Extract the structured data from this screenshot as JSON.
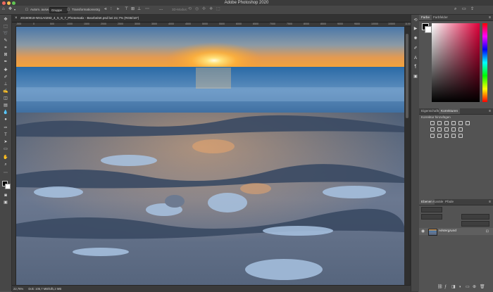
{
  "app": {
    "title": "Adobe Photoshop 2020"
  },
  "options_bar": {
    "mode_label": "Autom. ausw.:",
    "mode_value": "Gruppe",
    "transform_label": "Transformationsstrg",
    "mode3d_label": "3D-Modus:",
    "more_label": "..."
  },
  "document": {
    "tab_title": "20190919-NN1A0293_4_5_6_7_Photomatix - Bearbeitet.psd bei 22,7% (RGB/16*)",
    "close_glyph": "×",
    "zoom": "22,76%",
    "doc_info": "Dok: 105,7 MB/531,2 MB"
  },
  "ruler": {
    "labels": [
      "-500",
      "0",
      "500",
      "1000",
      "1500",
      "2000",
      "2500",
      "3000",
      "3500",
      "4000",
      "4500",
      "5000",
      "5500",
      "6000",
      "6500",
      "7000",
      "7500",
      "8000",
      "8500",
      "9000",
      "9500",
      "10000",
      "10500",
      "11000"
    ]
  },
  "panels": {
    "color": {
      "tabs": [
        "Farbe",
        "Farbfelder"
      ]
    },
    "properties": {
      "tabs": [
        "Eigenschaften",
        "Korrekturen"
      ],
      "hint": "Korrektur hinzufügen"
    },
    "layers": {
      "tabs": [
        "Ebenen",
        "Kanäle",
        "Pfade"
      ],
      "layer_name": "Hintergrund"
    }
  },
  "icons": {
    "close": "close-icon",
    "visibility": "eye-icon",
    "lock": "lock-icon"
  },
  "colors": {
    "app_bg": "#535353",
    "canvas_bg": "#282828",
    "foreground_swatch": "#000000",
    "background_swatch": "#ffffff"
  }
}
